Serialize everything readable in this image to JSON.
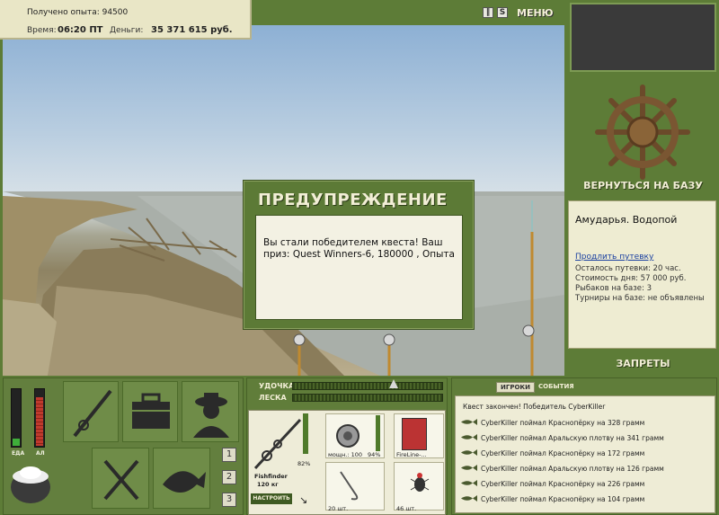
{
  "stats": {
    "exp_label": "Получено опыта: 94500",
    "time_label": "Время:",
    "time_value": "06:20 ПТ",
    "money_label": "Деньги:",
    "money_value": "35 371 615 руб."
  },
  "top_controls": {
    "pause_icon": "pause-icon",
    "sound_icon": "sound-icon",
    "menu_label": "МЕНЮ"
  },
  "dialog": {
    "title": "ПРЕДУПРЕЖДЕНИЕ",
    "message": "Вы стали победителем квеста! Ваш приз: Quest Winners-6, 180000 , Опыта"
  },
  "base": {
    "return_label": "ВЕРНУТЬСЯ НА БАЗУ",
    "place": "Амударья. Водопой",
    "extend_link": "Продлить путевку",
    "lines": [
      "Осталось путевки: 20 час.",
      "Стоимость дня: 57 000 руб.",
      "Рыбаков на базе: 3",
      "Турниры на базе: не объявлены"
    ],
    "bans_label": "ЗАПРЕТЫ"
  },
  "needs": {
    "food_label": "ЕДА",
    "alcohol_label": "АЛ",
    "food_level": 0.12,
    "alcohol_level": 0.85
  },
  "toolbar": {
    "slots": [
      "1",
      "2",
      "3"
    ]
  },
  "tackle": {
    "rod_label": "УДОЧКА",
    "line_label": "ЛЕСКА",
    "rod_name": "Fishfinder",
    "rod_weight": "120 кг",
    "rod_percent": "82%",
    "setup_label": "НАСТРОИТЬ",
    "reel_power": "мощн.: 100",
    "reel_percent": "94%",
    "line_name": "FireLine-...",
    "hook_count": "20 шт.",
    "bait_count": "46 шт."
  },
  "chat": {
    "tab_players": "ИГРОКИ",
    "tab_events": "СОБЫТИЯ",
    "header": "Квест закончен! Победитель CyberKiller",
    "lines": [
      "CyberKiller поймал Краснопёрку на 328 грамм",
      "CyberKiller поймал Аральскую плотву на 341 грамм",
      "CyberKiller поймал Краснопёрку на 172 грамм",
      "CyberKiller поймал Аральскую плотву на 126 грамм",
      "CyberKiller поймал Краснопёрку на 226 грамм",
      "CyberKiller поймал Краснопёрку на 104 грамм"
    ]
  },
  "colors": {
    "panel_green": "#5d7c37",
    "cream": "#eeecd2",
    "food_bar": "#3fae3a",
    "alcohol_bar": "#c03a2e"
  }
}
